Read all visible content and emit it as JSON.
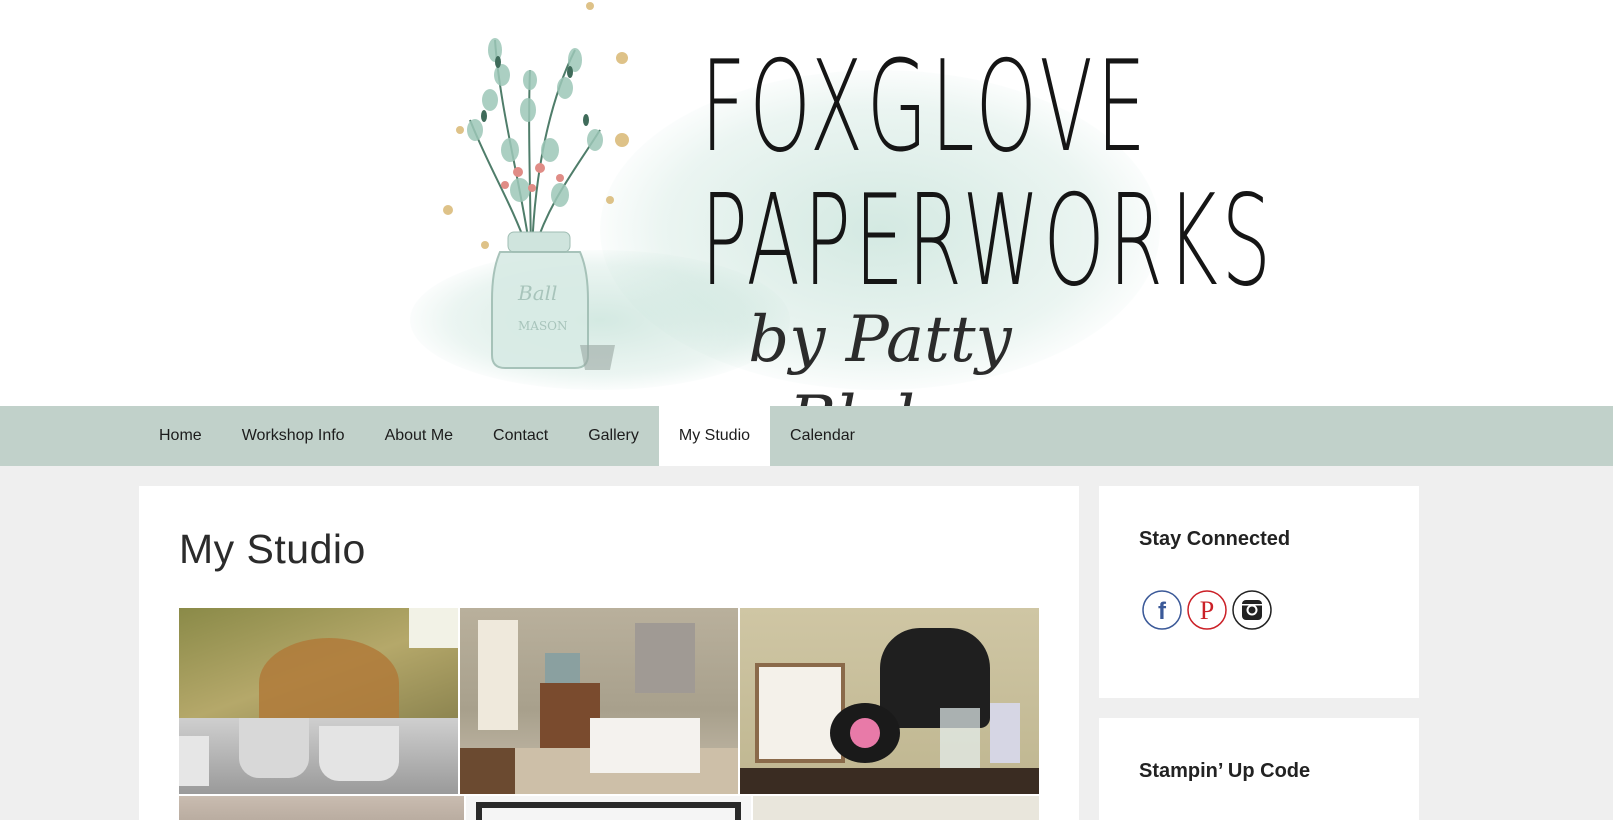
{
  "header": {
    "logo_line_1": "FOXGLOVE",
    "logo_line_2": "PAPERWORKS",
    "logo_byline": "by Patty Blake"
  },
  "nav": {
    "items": [
      {
        "label": "Home",
        "active": false
      },
      {
        "label": "Workshop Info",
        "active": false
      },
      {
        "label": "About Me",
        "active": false
      },
      {
        "label": "Contact",
        "active": false
      },
      {
        "label": "Gallery",
        "active": false
      },
      {
        "label": "My Studio",
        "active": true
      },
      {
        "label": "Calendar",
        "active": false
      }
    ]
  },
  "main": {
    "title": "My Studio"
  },
  "sidebar": {
    "stay_connected": {
      "title": "Stay Connected",
      "icons": [
        "facebook-icon",
        "pinterest-icon",
        "instagram-icon"
      ]
    },
    "stampin_up": {
      "title": "Stampin’ Up Code"
    }
  },
  "colors": {
    "nav_bg": "#c1d1ca",
    "page_bg": "#efefef",
    "facebook": "#3b5998",
    "pinterest": "#cb2027",
    "instagram": "#222222"
  }
}
